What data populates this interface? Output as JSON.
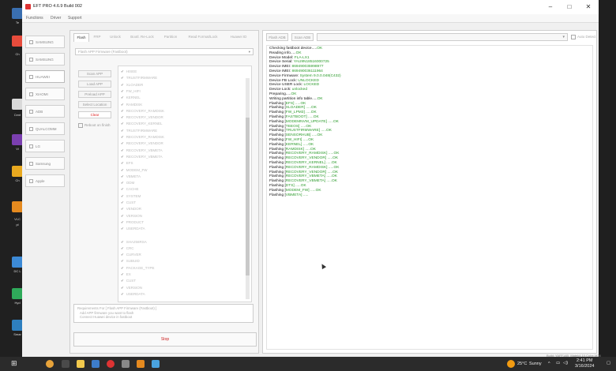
{
  "window": {
    "title": "EFT PRO 4.6.9 Build 002",
    "controls": [
      "–",
      "□",
      "✕"
    ]
  },
  "menu": [
    "Functions",
    "Driver",
    "Support"
  ],
  "sidebar": [
    {
      "label": "SAMSUNG",
      "icon": "samsung-icon"
    },
    {
      "label": "SAMSUNG",
      "icon": "samsung-icon"
    },
    {
      "label": "HUAWEI",
      "icon": "huawei-icon",
      "active": true
    },
    {
      "label": "XIAOMI",
      "icon": "xiaomi-icon"
    },
    {
      "label": "ADB",
      "icon": "adb-icon"
    },
    {
      "label": "QUALCOMM",
      "icon": "qualcomm-icon"
    },
    {
      "label": "LG",
      "icon": "lg-icon"
    },
    {
      "label": "Samsung",
      "icon": "samsung-icon"
    },
    {
      "label": "Apple",
      "icon": "apple-icon"
    }
  ],
  "tabs": [
    "Flash",
    "FRP",
    "Unlock",
    "Bootl. Re-Lock",
    "Partition",
    "Read Format/Lock",
    "Huawei ID"
  ],
  "firmware_select": {
    "value": "Flash APP Firmware (Fastboot)"
  },
  "action_buttons": [
    "Scan APP",
    "Load APP",
    "Preload APP",
    "Select Location",
    "Clear"
  ],
  "reboot_option": "Reboot on finish",
  "partitions": [
    "HISEE",
    "TRUSTFIRMWARE",
    "XLOADER",
    "FW_HIFI",
    "KERNEL",
    "RAMDISK",
    "RECOVERY_RAMDISK",
    "RECOVERY_VENDOR",
    "RECOVERY_KERNEL",
    "TRUSTFIRMWARE",
    "RECOVERY_RAMDISK",
    "RECOVERY_VENDOR",
    "RECOVERY_VBMETA",
    "RECOVERY_VBMETA",
    "EFS",
    "MODEM_FW",
    "VBMETA",
    "ODM",
    "CACHE",
    "SYSTEM",
    "CUST",
    "VENDOR",
    "VERSION",
    "PRODUCT",
    "USERDATA",
    "SHA256RSA",
    "CRC",
    "CURVER",
    "SUBUID",
    "PACKAGE_TYPE",
    "EX",
    "CUST",
    "VERSION",
    "USERDATA"
  ],
  "requirements": [
    "Requirements For [ Flash APP Firmware (Fastboot) ]",
    "Add APP firmware you want to flash",
    "Connect Huawei device in fastboot"
  ],
  "stop_label": "Stop",
  "right_buttons": [
    "Flash ADB",
    "Scan ADB"
  ],
  "auto_detect": "Auto Detect",
  "log": [
    {
      "text": "Checking fastboot device.....",
      "value": "OK"
    },
    {
      "text": "Reading info.....",
      "value": "OK"
    },
    {
      "text": "Device Model: ",
      "value": "FLA-LX1"
    },
    {
      "text": "Device Serial: ",
      "value": "YAU9N18516000725"
    },
    {
      "text": "Device IMEI: ",
      "value": "869490035998977"
    },
    {
      "text": "Device IMEI: ",
      "value": "869490036111964"
    },
    {
      "text": "Device Firmware: ",
      "value": "System 9.0.0.048(C432)"
    },
    {
      "text": "Device FB Lock: ",
      "value": "UNLOCKED"
    },
    {
      "text": "Device USER Lock: ",
      "value": "LOCKED"
    },
    {
      "text": "Device Lock: ",
      "value": "unlocked"
    },
    {
      "text": "Preparing.....",
      "value": "OK"
    },
    {
      "text": "Writing partition info table.....",
      "value": "OK"
    },
    {
      "text": "Flashing [",
      "value": "EFS] .....OK"
    },
    {
      "text": "Flashing [",
      "value": "XLOADER] .....OK"
    },
    {
      "text": "Flashing [",
      "value": "FW_LPM3] .....OK"
    },
    {
      "text": "Flashing [",
      "value": "FASTBOOT] .....OK"
    },
    {
      "text": "Flashing [",
      "value": "MODEMNVM_UPDATE] .....OK"
    },
    {
      "text": "Flashing [",
      "value": "TEEOS] .....OK"
    },
    {
      "text": "Flashing [",
      "value": "TRUSTFIRMWARE] .....OK"
    },
    {
      "text": "Flashing [",
      "value": "SENSORHUB] .....OK"
    },
    {
      "text": "Flashing [",
      "value": "FW_HIFI] .....OK"
    },
    {
      "text": "Flashing [",
      "value": "KERNEL] .....OK"
    },
    {
      "text": "Flashing [",
      "value": "RAMDISK] .....OK"
    },
    {
      "text": "Flashing [",
      "value": "RECOVERY_RAMDISK] .....OK"
    },
    {
      "text": "Flashing [",
      "value": "RECOVERY_VENDOR] .....OK"
    },
    {
      "text": "Flashing [",
      "value": "RECOVERY_KERNEL] .....OK"
    },
    {
      "text": "Flashing [",
      "value": "RECOVERY_RAMDISK] .....OK"
    },
    {
      "text": "Flashing [",
      "value": "RECOVERY_VENDOR] .....OK"
    },
    {
      "text": "Flashing [",
      "value": "RECOVERY_VBMETA] .....OK"
    },
    {
      "text": "Flashing [",
      "value": "RECOVERY_VBMETA] .....OK"
    },
    {
      "text": "Flashing [",
      "value": "DTS] .....OK"
    },
    {
      "text": "Flashing [",
      "value": "MODEM_FW] .....OK"
    },
    {
      "text": "Flashing [",
      "value": "VBMETA] ....."
    }
  ],
  "watermark": "Build: YAFF14B_Matek4.10.Cube-M28",
  "taskbar": {
    "weather_temp": "25°C",
    "weather_text": "Sunny",
    "time": "2:41 PM",
    "date": "3/16/2024"
  },
  "desktop_labels": [
    "Te",
    "Ch",
    "Cent",
    "Vi",
    "Ch",
    "VLC",
    "pl",
    "DC L",
    "Hyd",
    "Smar"
  ],
  "colors": {
    "ok_green": "#2a9a2a",
    "clear_red": "#dd2222",
    "titlebar": "#ffffff",
    "window_bg": "#f0f0f0",
    "taskbar": "#2b2b2b"
  }
}
